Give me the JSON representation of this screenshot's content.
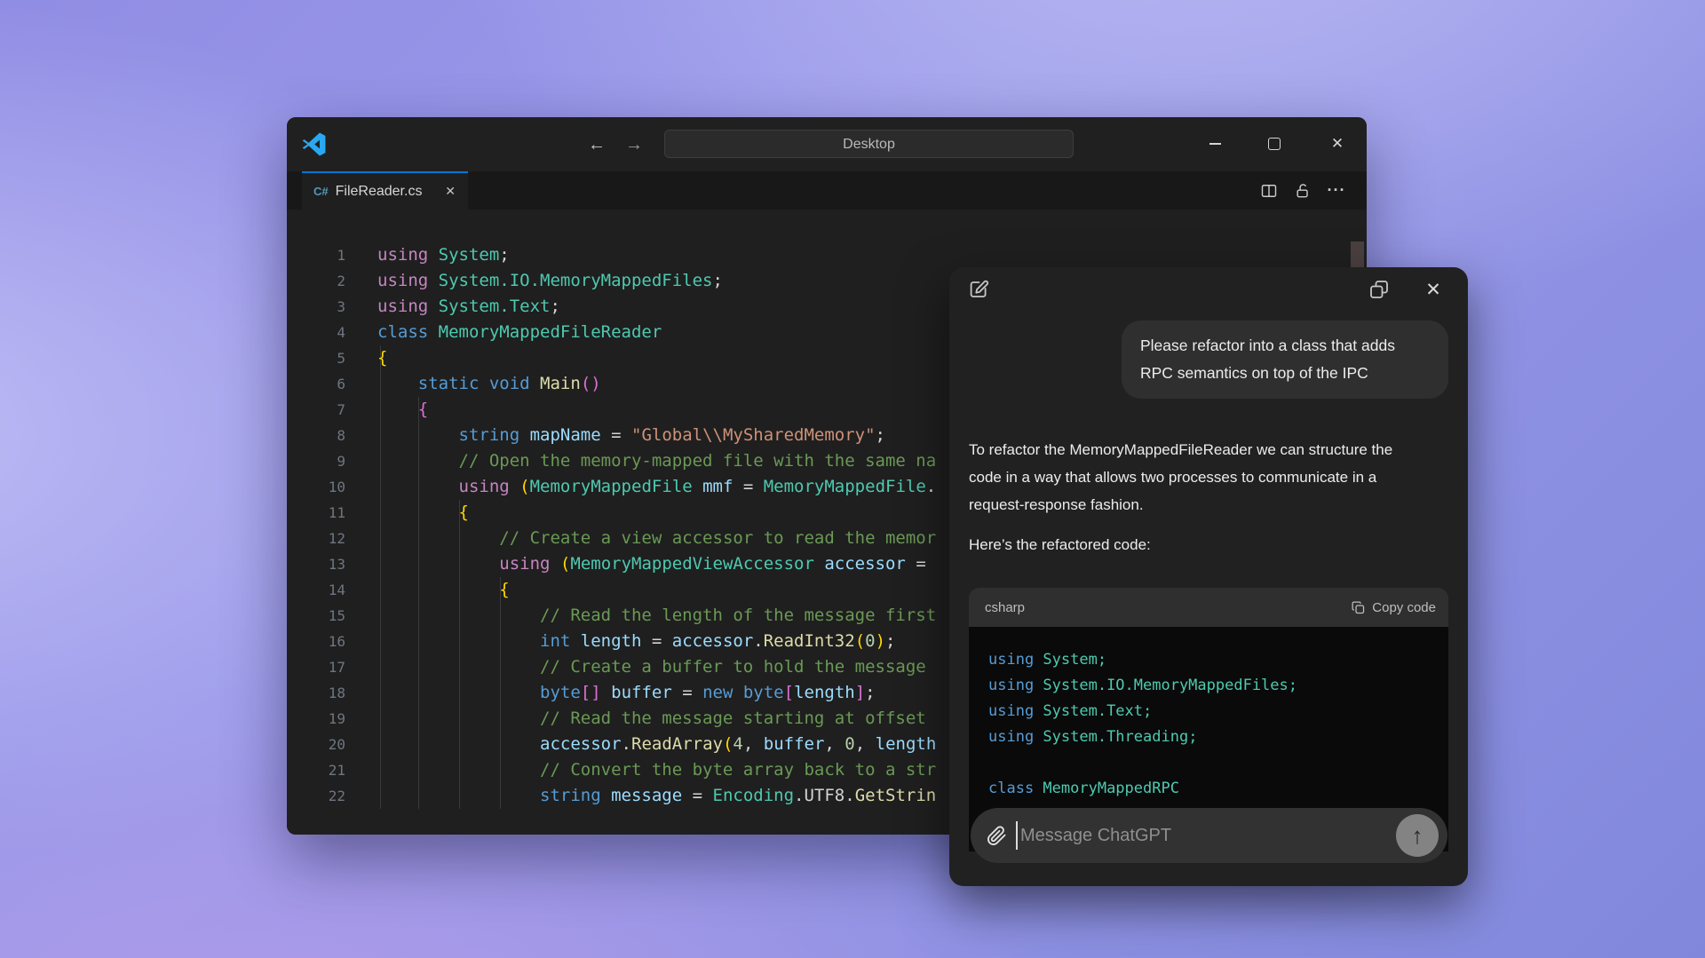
{
  "colors": {
    "tab_accent": "#0078d4",
    "logo_blue": "#29a8f1",
    "csharp_icon": "#519aba",
    "editor_bg": "#1f1f1f",
    "chat_bg": "#212121",
    "chat_code_bg": "#0a0a0a"
  },
  "icons": {
    "back": "←",
    "forward": "→",
    "window_close": "✕",
    "tab_close": "✕",
    "ellipsis": "···",
    "csharp": "C#",
    "chat_close": "✕",
    "send_arrow": "↑"
  },
  "vscode": {
    "title_bar": {
      "search_value": "Desktop"
    },
    "tab": {
      "file_name": "FileReader.cs"
    },
    "editor": {
      "lines": [
        [
          [
            "using ",
            "kp"
          ],
          [
            "System",
            "ty"
          ],
          [
            ";",
            "p"
          ]
        ],
        [
          [
            "using ",
            "kp"
          ],
          [
            "System.IO.MemoryMappedFiles",
            "ty"
          ],
          [
            ";",
            "p"
          ]
        ],
        [
          [
            "using ",
            "kp"
          ],
          [
            "System.Text",
            "ty"
          ],
          [
            ";",
            "p"
          ]
        ],
        [
          [
            "class ",
            "kb"
          ],
          [
            "MemoryMappedFileReader",
            "ty"
          ]
        ],
        [
          [
            "{",
            "bg"
          ]
        ],
        [
          [
            "    ",
            "p"
          ],
          [
            "static ",
            "kb"
          ],
          [
            "void ",
            "kb"
          ],
          [
            "Main",
            "me"
          ],
          [
            "()",
            "bp"
          ]
        ],
        [
          [
            "    ",
            "p"
          ],
          [
            "{",
            "bp"
          ]
        ],
        [
          [
            "        ",
            "p"
          ],
          [
            "string ",
            "kb"
          ],
          [
            "mapName ",
            "va"
          ],
          [
            "= ",
            "p"
          ],
          [
            "\"Global\\\\MySharedMemory\"",
            "st"
          ],
          [
            ";",
            "p"
          ]
        ],
        [
          [
            "        ",
            "p"
          ],
          [
            "// Open the memory-mapped file with the same na",
            "cm"
          ]
        ],
        [
          [
            "        ",
            "p"
          ],
          [
            "using ",
            "kp"
          ],
          [
            "(",
            "bg"
          ],
          [
            "MemoryMappedFile ",
            "ty"
          ],
          [
            "mmf ",
            "va"
          ],
          [
            "= ",
            "p"
          ],
          [
            "MemoryMappedFile",
            "ty"
          ],
          [
            ".",
            "p"
          ]
        ],
        [
          [
            "        ",
            "p"
          ],
          [
            "{",
            "bg"
          ]
        ],
        [
          [
            "            ",
            "p"
          ],
          [
            "// Create a view accessor to read the memor",
            "cm"
          ]
        ],
        [
          [
            "            ",
            "p"
          ],
          [
            "using ",
            "kp"
          ],
          [
            "(",
            "bg"
          ],
          [
            "MemoryMappedViewAccessor ",
            "ty"
          ],
          [
            "accessor ",
            "va"
          ],
          [
            "=",
            "p"
          ]
        ],
        [
          [
            "            ",
            "p"
          ],
          [
            "{",
            "bg"
          ]
        ],
        [
          [
            "                ",
            "p"
          ],
          [
            "// Read the length of the message first",
            "cm"
          ]
        ],
        [
          [
            "                ",
            "p"
          ],
          [
            "int ",
            "kb"
          ],
          [
            "length ",
            "va"
          ],
          [
            "= ",
            "p"
          ],
          [
            "accessor",
            "va"
          ],
          [
            ".",
            "p"
          ],
          [
            "ReadInt32",
            "me"
          ],
          [
            "(",
            "bg"
          ],
          [
            "0",
            "nu"
          ],
          [
            ")",
            "bg"
          ],
          [
            ";",
            "p"
          ]
        ],
        [
          [
            "                ",
            "p"
          ],
          [
            "// Create a buffer to hold the message",
            "cm"
          ]
        ],
        [
          [
            "                ",
            "p"
          ],
          [
            "byte",
            "kb"
          ],
          [
            "[] ",
            "bp"
          ],
          [
            "buffer ",
            "va"
          ],
          [
            "= ",
            "p"
          ],
          [
            "new ",
            "kb"
          ],
          [
            "byte",
            "kb"
          ],
          [
            "[",
            "bp"
          ],
          [
            "length",
            "va"
          ],
          [
            "]",
            "bp"
          ],
          [
            ";",
            "p"
          ]
        ],
        [
          [
            "                ",
            "p"
          ],
          [
            "// Read the message starting at offset ",
            "cm"
          ]
        ],
        [
          [
            "                ",
            "p"
          ],
          [
            "accessor",
            "va"
          ],
          [
            ".",
            "p"
          ],
          [
            "ReadArray",
            "me"
          ],
          [
            "(",
            "bg"
          ],
          [
            "4",
            "nu"
          ],
          [
            ", ",
            "p"
          ],
          [
            "buffer",
            "va"
          ],
          [
            ", ",
            "p"
          ],
          [
            "0",
            "nu"
          ],
          [
            ", ",
            "p"
          ],
          [
            "length",
            "va"
          ]
        ],
        [
          [
            "                ",
            "p"
          ],
          [
            "// Convert the byte array back to a str",
            "cm"
          ]
        ],
        [
          [
            "                ",
            "p"
          ],
          [
            "string ",
            "kb"
          ],
          [
            "message ",
            "va"
          ],
          [
            "= ",
            "p"
          ],
          [
            "Encoding",
            "ty"
          ],
          [
            ".",
            "p"
          ],
          [
            "UTF8",
            "p"
          ],
          [
            ".",
            "p"
          ],
          [
            "GetStrin",
            "me"
          ]
        ]
      ]
    }
  },
  "chatgpt": {
    "user_message": "Please refactor into a class that adds RPC semantics on top of the IPC",
    "response_intro": "To refactor the MemoryMappedFileReader we can structure the code in a way that allows two processes to communicate in a request-response fashion.",
    "response_lead": "Here’s the refactored code:",
    "code_header": {
      "language": "csharp",
      "copy_label": "Copy code"
    },
    "code_lines": [
      [
        [
          "using ",
          "kb"
        ],
        [
          "System",
          "ty"
        ],
        [
          ";",
          "ty"
        ]
      ],
      [
        [
          "using ",
          "kb"
        ],
        [
          "System.IO.MemoryMappedFiles",
          "ty"
        ],
        [
          ";",
          "ty"
        ]
      ],
      [
        [
          "using ",
          "kb"
        ],
        [
          "System.Text",
          "ty"
        ],
        [
          ";",
          "ty"
        ]
      ],
      [
        [
          "using ",
          "kb"
        ],
        [
          "System.Threading",
          "ty"
        ],
        [
          ";",
          "ty"
        ]
      ],
      [],
      [
        [
          "class ",
          "kb"
        ],
        [
          "MemoryMappedRPC",
          "ty"
        ]
      ]
    ],
    "input": {
      "placeholder": "Message ChatGPT"
    }
  }
}
